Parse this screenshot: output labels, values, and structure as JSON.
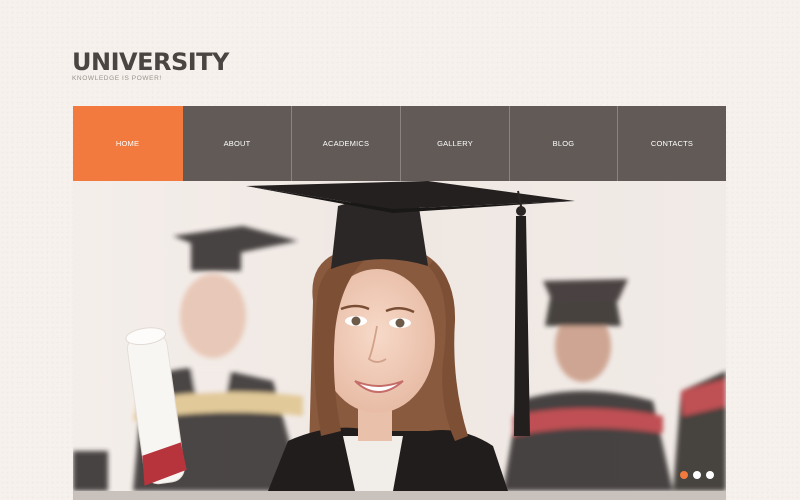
{
  "site": {
    "logo": "UNIVERSITY",
    "tagline": "KNOWLEDGE IS POWER!"
  },
  "nav": {
    "items": [
      {
        "label": "HOME",
        "active": true
      },
      {
        "label": "ABOUT",
        "active": false
      },
      {
        "label": "ACADEMICS",
        "active": false
      },
      {
        "label": "GALLERY",
        "active": false
      },
      {
        "label": "BLOG",
        "active": false
      },
      {
        "label": "CONTACTS",
        "active": false
      }
    ]
  },
  "slider": {
    "image": "graduate-photo",
    "slide_count": 3,
    "active_slide": 1
  },
  "colors": {
    "accent": "#f27a3e",
    "nav_bg": "#615a56",
    "logo_text": "#4a4542",
    "page_bg": "#f6f1ec"
  }
}
